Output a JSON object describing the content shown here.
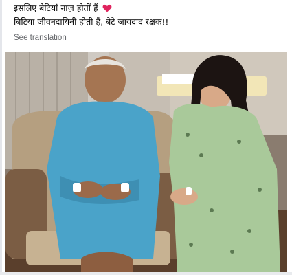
{
  "post": {
    "line1": "इसलिए बेटियां नाज़ होतीं हैं",
    "line2": "बिटिया जीवनदायिनी होती हैं, बेटे जायदाद रक्षक!!",
    "see_translation": "See translation",
    "heart_icon": "red-heart-icon"
  },
  "photo": {
    "description_icon": "photo",
    "colors": {
      "gown": "#4aa3c9",
      "curtain": "#bdb6ad",
      "chair": "#b69d7a",
      "green_outfit": "#a9c99a"
    }
  }
}
